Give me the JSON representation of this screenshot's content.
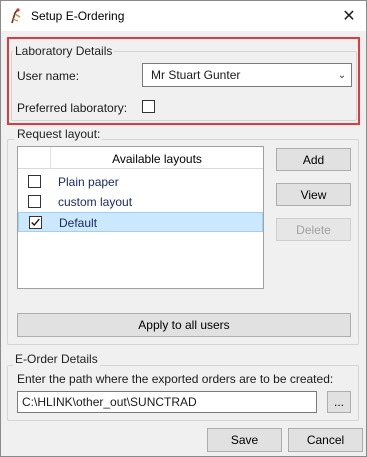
{
  "window": {
    "title": "Setup E-Ordering",
    "close_symbol": "✕"
  },
  "lab_details": {
    "group_title": "Laboratory Details",
    "user_name_label": "User name:",
    "user_name_value": "Mr Stuart Gunter",
    "preferred_lab_label": "Preferred laboratory:",
    "preferred_lab_checked": false
  },
  "request_layout": {
    "group_title": "Request layout:",
    "list_header": "Available layouts",
    "items": [
      {
        "label": "Plain paper",
        "checked": false,
        "selected": false
      },
      {
        "label": "custom layout",
        "checked": false,
        "selected": false
      },
      {
        "label": "Default",
        "checked": true,
        "selected": true
      }
    ],
    "add_label": "Add",
    "view_label": "View",
    "delete_label": "Delete",
    "apply_all_label": "Apply to all users"
  },
  "eorder": {
    "group_title": "E-Order Details",
    "instruction": "Enter the path where the exported orders are to be created:",
    "path_value": "C:\\HLINK\\other_out\\SUNCTRAD",
    "browse_label": "..."
  },
  "footer": {
    "save_label": "Save",
    "cancel_label": "Cancel"
  },
  "colors": {
    "highlight": "#e0393e",
    "selection": "#cce8ff"
  }
}
